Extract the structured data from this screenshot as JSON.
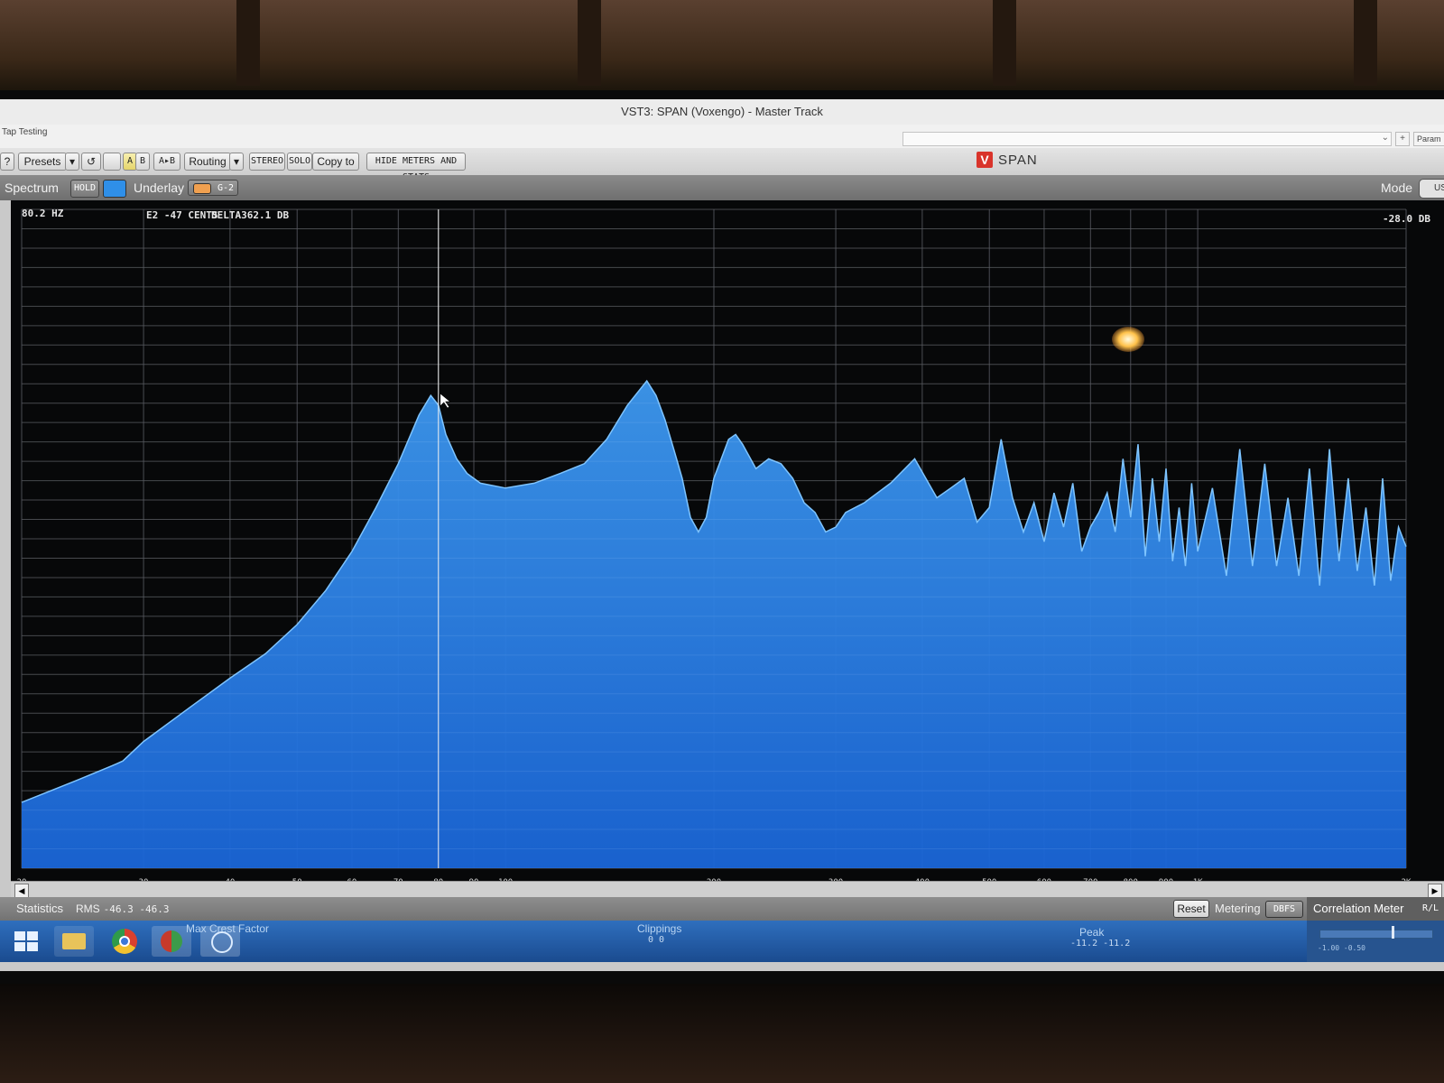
{
  "window": {
    "title": "VST3: SPAN (Voxengo) - Master Track",
    "track_label": "Tap Testing",
    "param_label": "Param"
  },
  "toolbar": {
    "help_label": "?",
    "presets_label": "Presets",
    "a_label": "A",
    "b_label": "B",
    "a_to_b_label": "A▸B",
    "routing_label": "Routing",
    "stereo_label": "STEREO",
    "solo_label": "SOLO",
    "copy_to_label": "Copy to",
    "hide_meters_label": "HIDE METERS AND STATS",
    "logo_mark": "V",
    "logo_text": "SPAN"
  },
  "spectrum_bar": {
    "spectrum_label": "Spectrum",
    "hold_label": "HOLD",
    "underlay_label": "Underlay",
    "underlay_slot": "G-2",
    "mode_label": "Mode",
    "mode_value": "US",
    "hold_color": "#2f8fe8",
    "underlay_color": "#f0a050"
  },
  "readouts": {
    "frequency": "80.2 HZ",
    "note": "E2 -47 CENTS",
    "delta": "DELTA362.1 DB",
    "level": "-28.0 DB"
  },
  "chart_data": {
    "type": "area",
    "xscale": "log",
    "x_tick_labels": [
      "20",
      "30",
      "40",
      "50",
      "60",
      "70",
      "80",
      "90",
      "100",
      "200",
      "300",
      "400",
      "500",
      "600",
      "700",
      "800",
      "900",
      "1K",
      "2K"
    ],
    "xlim_hz": [
      20,
      2000
    ],
    "grid": true,
    "fill_color": "#1a66d8",
    "line_color": "#7ec4ff",
    "series": [
      {
        "x": [
          20,
          24,
          27,
          28,
          30,
          35,
          40,
          45,
          50,
          55,
          60,
          65,
          70,
          75,
          78,
          80,
          82,
          85,
          88,
          92,
          100,
          110,
          120,
          130,
          140,
          150,
          160,
          165,
          170,
          175,
          180,
          185,
          190,
          195,
          200,
          205,
          210,
          215,
          220,
          230,
          240,
          250,
          260,
          270,
          280,
          290,
          300,
          310,
          330,
          360,
          390,
          420,
          440,
          460,
          480,
          500,
          520,
          540,
          560,
          580,
          600,
          620,
          640,
          660,
          680,
          700,
          720,
          740,
          760,
          780,
          800,
          820,
          840,
          860,
          880,
          900,
          920,
          940,
          960,
          980,
          1000,
          1050,
          1100,
          1150,
          1200,
          1250,
          1300,
          1350,
          1400,
          1450,
          1500,
          1550,
          1600,
          1650,
          1700,
          1750,
          1800,
          1850,
          1900,
          1950,
          2000
        ],
        "y": [
          0.135,
          0.18,
          0.21,
          0.22,
          0.26,
          0.33,
          0.39,
          0.44,
          0.5,
          0.57,
          0.65,
          0.74,
          0.83,
          0.93,
          0.97,
          0.95,
          0.89,
          0.84,
          0.81,
          0.79,
          0.78,
          0.79,
          0.81,
          0.83,
          0.88,
          0.95,
          1.0,
          0.97,
          0.92,
          0.86,
          0.8,
          0.72,
          0.69,
          0.72,
          0.8,
          0.84,
          0.88,
          0.89,
          0.87,
          0.82,
          0.84,
          0.83,
          0.8,
          0.75,
          0.73,
          0.69,
          0.7,
          0.73,
          0.75,
          0.79,
          0.84,
          0.76,
          0.78,
          0.8,
          0.71,
          0.74,
          0.88,
          0.76,
          0.69,
          0.75,
          0.67,
          0.77,
          0.7,
          0.79,
          0.65,
          0.7,
          0.73,
          0.77,
          0.69,
          0.84,
          0.72,
          0.87,
          0.64,
          0.8,
          0.67,
          0.82,
          0.63,
          0.74,
          0.62,
          0.79,
          0.65,
          0.78,
          0.6,
          0.86,
          0.62,
          0.83,
          0.62,
          0.76,
          0.6,
          0.82,
          0.58,
          0.86,
          0.63,
          0.8,
          0.61,
          0.74,
          0.58,
          0.8,
          0.59,
          0.7,
          0.66
        ]
      }
    ]
  },
  "statistics": {
    "label": "Statistics",
    "rms_label": "RMS",
    "rms_values": "-46.3  -46.3",
    "reset_label": "Reset",
    "metering_label": "Metering",
    "metering_value": "DBFS",
    "correlation_label": "Correlation Meter",
    "correlation_mode": "R/L",
    "max_crest_label": "Max Crest Factor",
    "clippings_label": "Clippings",
    "clippings_values": "0   0",
    "peak_label": "Peak",
    "peak_values": "-11.2  -11.2",
    "corr_ticks": "-1.00   -0.50"
  }
}
